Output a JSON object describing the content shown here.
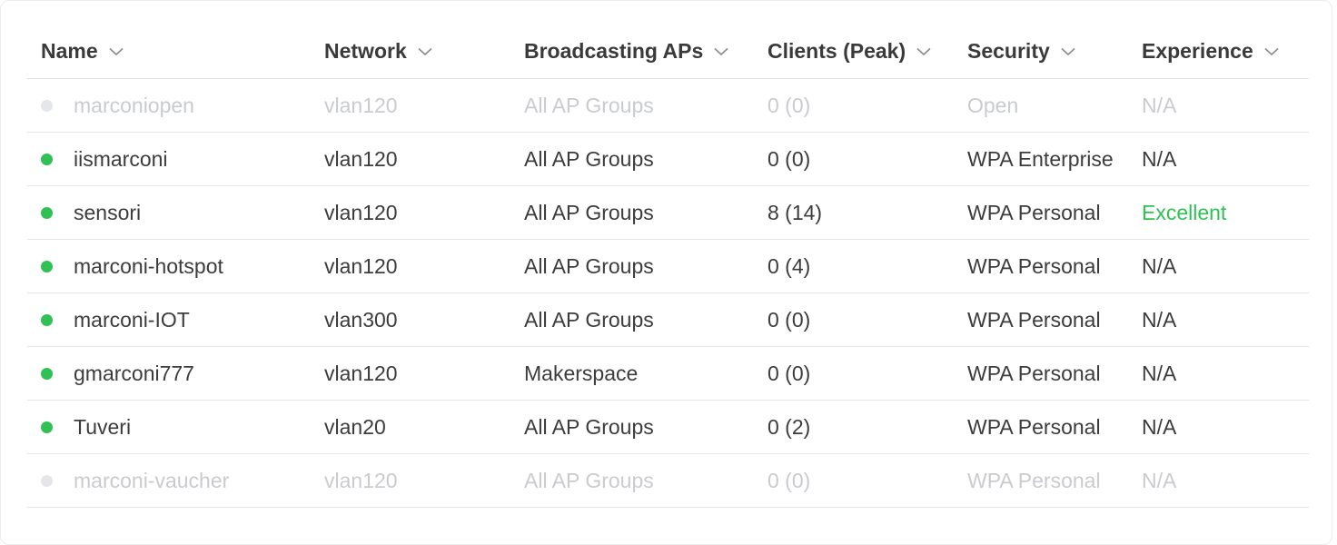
{
  "table": {
    "columns": [
      {
        "key": "name",
        "label": "Name"
      },
      {
        "key": "network",
        "label": "Network"
      },
      {
        "key": "aps",
        "label": "Broadcasting APs"
      },
      {
        "key": "clients",
        "label": "Clients (Peak)"
      },
      {
        "key": "security",
        "label": "Security"
      },
      {
        "key": "experience",
        "label": "Experience"
      }
    ],
    "rows": [
      {
        "status": "inactive",
        "name": "marconiopen",
        "network": "vlan120",
        "aps": "All AP Groups",
        "clients": "0 (0)",
        "security": "Open",
        "experience": "N/A"
      },
      {
        "status": "active",
        "name": "iismarconi",
        "network": "vlan120",
        "aps": "All AP Groups",
        "clients": "0 (0)",
        "security": "WPA Enterprise",
        "experience": "N/A"
      },
      {
        "status": "active",
        "name": "sensori",
        "network": "vlan120",
        "aps": "All AP Groups",
        "clients": "8 (14)",
        "security": "WPA Personal",
        "experience": "Excellent"
      },
      {
        "status": "active",
        "name": "marconi-hotspot",
        "network": "vlan120",
        "aps": "All AP Groups",
        "clients": "0 (4)",
        "security": "WPA Personal",
        "experience": "N/A"
      },
      {
        "status": "active",
        "name": "marconi-IOT",
        "network": "vlan300",
        "aps": "All AP Groups",
        "clients": "0 (0)",
        "security": "WPA Personal",
        "experience": "N/A"
      },
      {
        "status": "active",
        "name": "gmarconi777",
        "network": "vlan120",
        "aps": "Makerspace",
        "clients": "0 (0)",
        "security": "WPA Personal",
        "experience": "N/A"
      },
      {
        "status": "active",
        "name": "Tuveri",
        "network": "vlan20",
        "aps": "All AP Groups",
        "clients": "0 (2)",
        "security": "WPA Personal",
        "experience": "N/A"
      },
      {
        "status": "inactive",
        "name": "marconi-vaucher",
        "network": "vlan120",
        "aps": "All AP Groups",
        "clients": "0 (0)",
        "security": "WPA Personal",
        "experience": "N/A"
      }
    ]
  },
  "icons": {
    "sort": "chevron-down-icon",
    "status": "status-dot-icon"
  },
  "colors": {
    "active": "#2fc153",
    "inactive": "#e4e6ea",
    "excellent": "#2fc153",
    "text": "#3c3c3c",
    "disabled_text": "#c9cbcf"
  }
}
